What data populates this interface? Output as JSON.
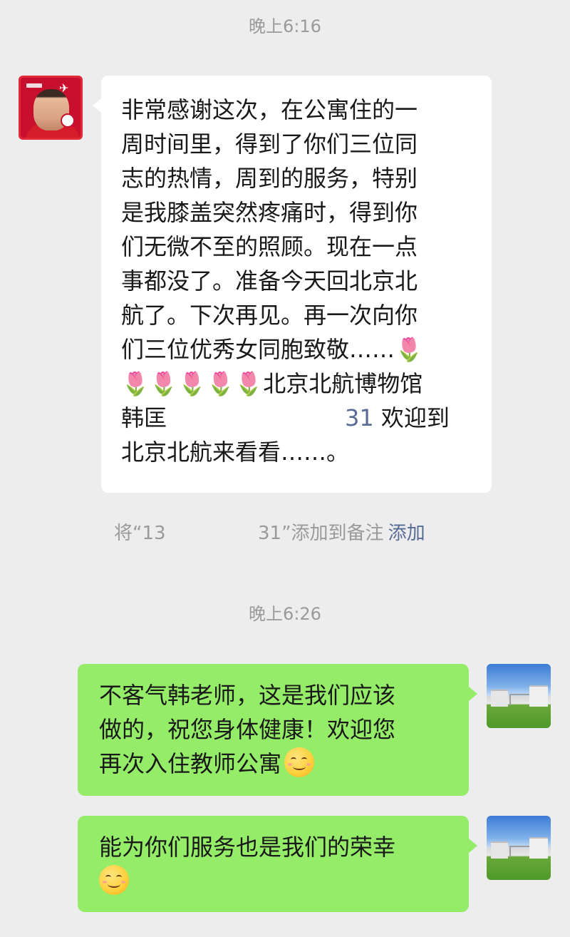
{
  "timestamps": {
    "first": "晚上6:16",
    "second": "晚上6:26"
  },
  "incoming": {
    "avatar_icon": "user-avatar-red-portrait",
    "lines": [
      "非常感谢这次，在公寓住的一",
      "周时间里，得到了你们三位同",
      "志的热情，周到的服务，特别",
      "是我膝盖突然疼痛时，得到你",
      "们无微不至的照顾。现在一点",
      "事都没了。准备今天回北京北",
      "航了。下次再见。再一次向你"
    ],
    "line8_text": "们三位优秀女同胞致敬……",
    "line9_text": "北京北航博物馆",
    "line10_prefix": "韩匡",
    "line10_number": "31",
    "line10_suffix": " 欢迎到",
    "line11": "北京北航来看看……。",
    "flower_icon": "tulip-emoji"
  },
  "remark_prompt": {
    "part1": "将“13",
    "part2": "31”添加到备注",
    "add_link": "添加"
  },
  "outgoing": {
    "avatar_icon": "user-avatar-campus-building",
    "message1_lines": [
      "不客气韩老师，这是我们应该",
      "做的，祝您身体健康！欢迎您"
    ],
    "message1_last": "再次入住教师公寓",
    "message2_line1": "能为你们服务也是我们的荣幸",
    "smile_icon": "smile-emoji"
  },
  "colors": {
    "background": "#ededed",
    "incoming_bubble": "#ffffff",
    "outgoing_bubble": "#95ec69",
    "link": "#576b95",
    "timestamp": "#9a9a9a"
  }
}
